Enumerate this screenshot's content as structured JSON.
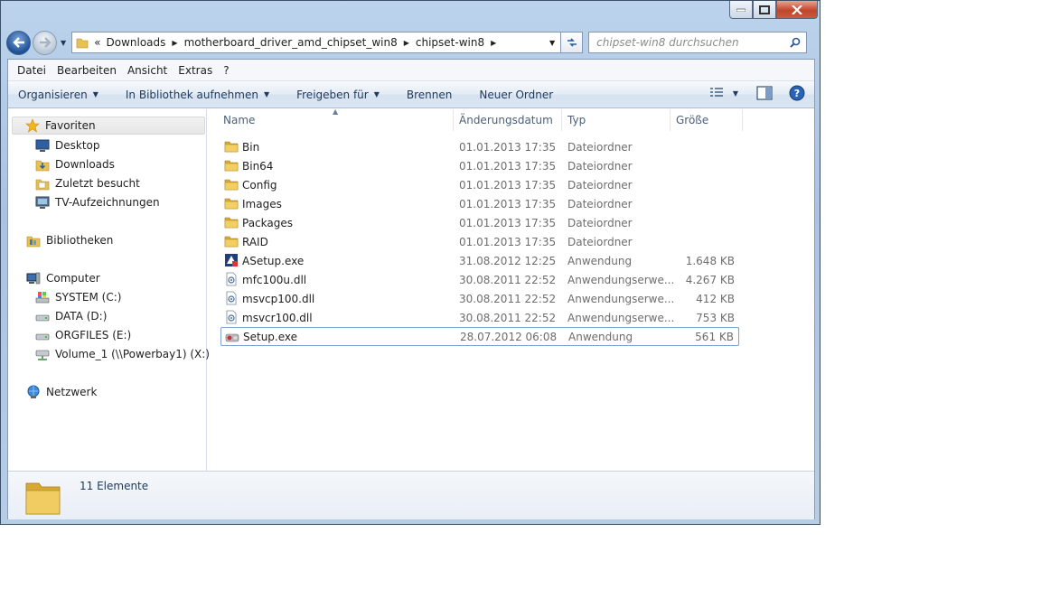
{
  "window": {
    "breadcrumbs": [
      "Downloads",
      "motherboard_driver_amd_chipset_win8",
      "chipset-win8"
    ],
    "search_placeholder": "chipset-win8 durchsuchen"
  },
  "menubar": [
    "Datei",
    "Bearbeiten",
    "Ansicht",
    "Extras",
    "?"
  ],
  "toolbar": {
    "organize": "Organisieren",
    "library": "In Bibliothek aufnehmen",
    "share": "Freigeben für",
    "burn": "Brennen",
    "new_folder": "Neuer Ordner"
  },
  "nav": {
    "favorites": "Favoriten",
    "fav_items": [
      "Desktop",
      "Downloads",
      "Zuletzt besucht",
      "TV-Aufzeichnungen"
    ],
    "libraries": "Bibliotheken",
    "computer": "Computer",
    "drives": [
      "SYSTEM (C:)",
      "DATA (D:)",
      "ORGFILES (E:)",
      "Volume_1 (\\\\Powerbay1) (X:)"
    ],
    "network": "Netzwerk"
  },
  "columns": {
    "name": "Name",
    "date": "Änderungsdatum",
    "type": "Typ",
    "size": "Größe"
  },
  "files": [
    {
      "name": "Bin",
      "date": "01.01.2013 17:35",
      "type": "Dateiordner",
      "size": "",
      "icon": "folder"
    },
    {
      "name": "Bin64",
      "date": "01.01.2013 17:35",
      "type": "Dateiordner",
      "size": "",
      "icon": "folder"
    },
    {
      "name": "Config",
      "date": "01.01.2013 17:35",
      "type": "Dateiordner",
      "size": "",
      "icon": "folder"
    },
    {
      "name": "Images",
      "date": "01.01.2013 17:35",
      "type": "Dateiordner",
      "size": "",
      "icon": "folder"
    },
    {
      "name": "Packages",
      "date": "01.01.2013 17:35",
      "type": "Dateiordner",
      "size": "",
      "icon": "folder"
    },
    {
      "name": "RAID",
      "date": "01.01.2013 17:35",
      "type": "Dateiordner",
      "size": "",
      "icon": "folder"
    },
    {
      "name": "ASetup.exe",
      "date": "31.08.2012 12:25",
      "type": "Anwendung",
      "size": "1.648 KB",
      "icon": "exe"
    },
    {
      "name": "mfc100u.dll",
      "date": "30.08.2011 22:52",
      "type": "Anwendungserwe...",
      "size": "4.267 KB",
      "icon": "dll"
    },
    {
      "name": "msvcp100.dll",
      "date": "30.08.2011 22:52",
      "type": "Anwendungserwe...",
      "size": "412 KB",
      "icon": "dll"
    },
    {
      "name": "msvcr100.dll",
      "date": "30.08.2011 22:52",
      "type": "Anwendungserwe...",
      "size": "753 KB",
      "icon": "dll"
    },
    {
      "name": "Setup.exe",
      "date": "28.07.2012 06:08",
      "type": "Anwendung",
      "size": "561 KB",
      "icon": "setup"
    }
  ],
  "status": {
    "count": "11 Elemente"
  }
}
